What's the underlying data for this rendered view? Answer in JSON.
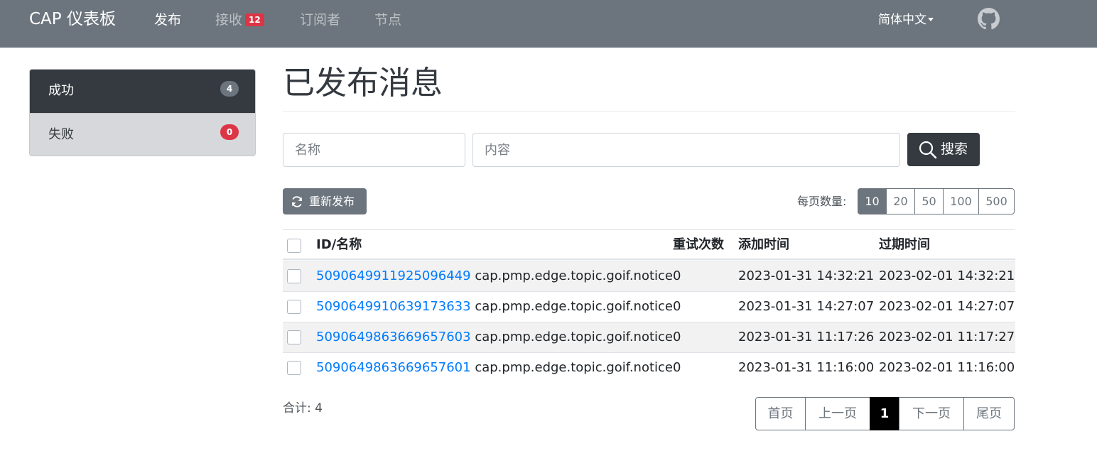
{
  "navbar": {
    "brand": "CAP 仪表板",
    "links": [
      {
        "label": "发布",
        "active": true
      },
      {
        "label": "接收",
        "badge": "12"
      },
      {
        "label": "订阅者"
      },
      {
        "label": "节点"
      }
    ],
    "language": "简体中文",
    "github_icon": "github-icon"
  },
  "sidebar": {
    "items": [
      {
        "label": "成功",
        "count": "4",
        "active": true
      },
      {
        "label": "失败",
        "count": "0",
        "active": false
      }
    ]
  },
  "main": {
    "title": "已发布消息",
    "search": {
      "name_placeholder": "名称",
      "content_placeholder": "内容",
      "button_label": "搜索"
    },
    "republish_label": "重新发布",
    "per_page": {
      "label": "每页数量:",
      "options": [
        "10",
        "20",
        "50",
        "100",
        "500"
      ],
      "selected": "10"
    },
    "table": {
      "headers": [
        "ID/名称",
        "重试次数",
        "添加时间",
        "过期时间"
      ],
      "rows": [
        {
          "id": "5090649911925096449",
          "name": "cap.pmp.edge.topic.goif.notice",
          "retries": "0",
          "added": "2023-01-31 14:32:21",
          "expires": "2023-02-01 14:32:21"
        },
        {
          "id": "5090649910639173633",
          "name": "cap.pmp.edge.topic.goif.notice",
          "retries": "0",
          "added": "2023-01-31 14:27:07",
          "expires": "2023-02-01 14:27:07"
        },
        {
          "id": "5090649863669657603",
          "name": "cap.pmp.edge.topic.goif.notice",
          "retries": "0",
          "added": "2023-01-31 11:17:26",
          "expires": "2023-02-01 11:17:27"
        },
        {
          "id": "5090649863669657601",
          "name": "cap.pmp.edge.topic.goif.notice",
          "retries": "0",
          "added": "2023-01-31 11:16:00",
          "expires": "2023-02-01 11:16:00"
        }
      ]
    },
    "total": "合计: 4",
    "pagination": {
      "first": "首页",
      "prev": "上一页",
      "current": "1",
      "next": "下一页",
      "last": "尾页"
    }
  },
  "colors": {
    "navbar_bg": "#6c757d",
    "sidebar_active_bg": "#343a40",
    "link": "#007bff",
    "danger": "#dc3545"
  }
}
